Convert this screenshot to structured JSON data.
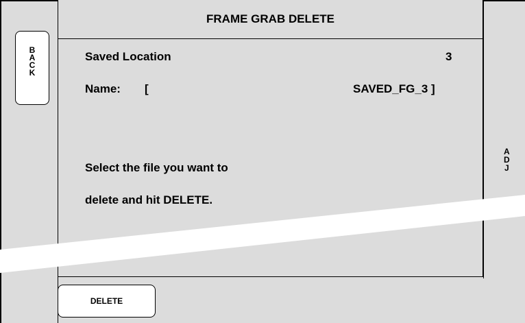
{
  "panel": {
    "title": "FRAME GRAB DELETE",
    "saved_location_label": "Saved Location",
    "saved_location_value": "3",
    "name_label": "Name:",
    "name_open_bracket": "[",
    "name_value": "SAVED_FG_3 ]",
    "instruction_line1": "Select the file you want to",
    "instruction_line2": "delete and hit DELETE."
  },
  "back_button": {
    "letters": [
      "B",
      "A",
      "C",
      "K"
    ]
  },
  "adj_label": {
    "letters": [
      "A",
      "D",
      "J"
    ]
  },
  "delete_button": {
    "label": "DELETE"
  }
}
